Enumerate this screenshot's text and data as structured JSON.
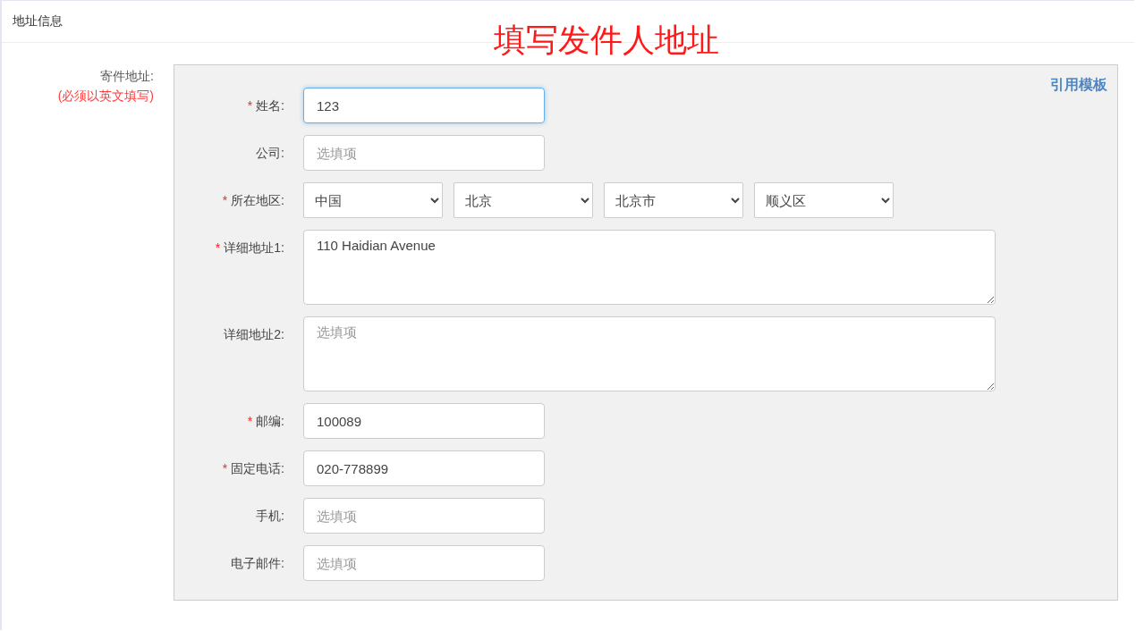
{
  "section": {
    "title": "地址信息"
  },
  "annotation": "填写发件人地址",
  "group": {
    "label": "寄件地址:",
    "note": "(必须以英文填写)",
    "template_link": "引用模板"
  },
  "fields": [
    {
      "kind": "input",
      "required_mark": "*",
      "label": "姓名:",
      "value": "123",
      "focused": true
    },
    {
      "kind": "input",
      "label": "公司:",
      "placeholder": "选填项",
      "focused": false
    },
    {
      "kind": "selects",
      "required_mark": "*",
      "label": "所在地区:",
      "options": [
        "中国",
        "北京",
        "北京市",
        "顺义区"
      ]
    },
    {
      "kind": "textarea",
      "required_mark": "*",
      "label": "详细地址1:",
      "value": "110 Haidian Avenue"
    },
    {
      "kind": "textarea",
      "label": "详细地址2:",
      "placeholder": "选填项"
    },
    {
      "kind": "input",
      "required_mark": "*",
      "label": "邮编:",
      "value": "100089",
      "focused": false
    },
    {
      "kind": "input",
      "required_mark": "*",
      "label": "固定电话:",
      "value": "020-778899",
      "focused": false
    },
    {
      "kind": "input",
      "label": "手机:",
      "placeholder": "选填项",
      "focused": false
    },
    {
      "kind": "input",
      "label": "电子邮件:",
      "placeholder": "选填项",
      "focused": false
    }
  ]
}
